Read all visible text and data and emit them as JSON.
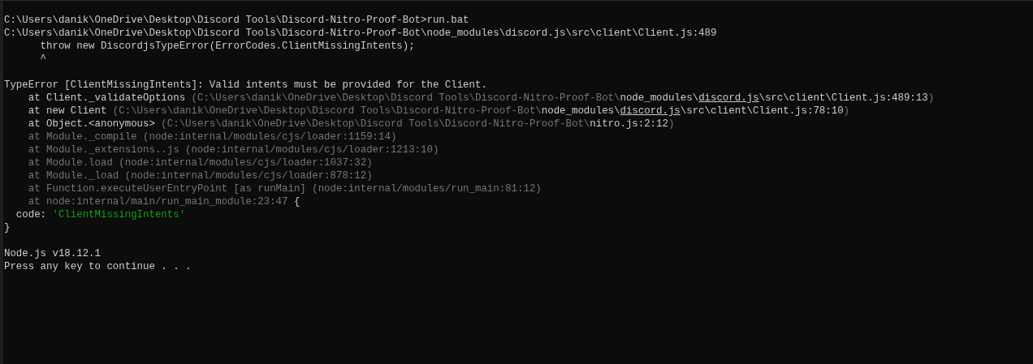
{
  "console": {
    "lines": [
      {
        "kind": "text",
        "segments": [
          {
            "kind": "plain",
            "text": "C:\\Users\\danik\\OneDrive\\Desktop\\Discord Tools\\Discord-Nitro-Proof-Bot>run.bat"
          }
        ]
      },
      {
        "kind": "text",
        "segments": [
          {
            "kind": "plain",
            "text": "C:\\Users\\danik\\OneDrive\\Desktop\\Discord Tools\\Discord-Nitro-Proof-Bot\\node_modules\\discord.js\\src\\client\\Client.js:489"
          }
        ]
      },
      {
        "kind": "text",
        "segments": [
          {
            "kind": "plain",
            "text": "      throw new DiscordjsTypeError(ErrorCodes.ClientMissingIntents);"
          }
        ]
      },
      {
        "kind": "text",
        "segments": [
          {
            "kind": "plain",
            "text": "      ^"
          }
        ]
      },
      {
        "kind": "blank"
      },
      {
        "kind": "text",
        "segments": [
          {
            "kind": "plain",
            "text": "TypeError [ClientMissingIntents]: Valid intents must be provided for the Client."
          }
        ]
      },
      {
        "kind": "text",
        "segments": [
          {
            "kind": "plain",
            "text": "    at Client._validateOptions "
          },
          {
            "kind": "dim",
            "text": "(C:\\Users\\danik\\OneDrive\\Desktop\\Discord Tools\\Discord-Nitro-Proof-Bot\\"
          },
          {
            "kind": "plain",
            "text": "node_modules\\"
          },
          {
            "kind": "link",
            "text": "discord.js"
          },
          {
            "kind": "plain",
            "text": "\\src\\client\\Client.js:489:13"
          },
          {
            "kind": "dim",
            "text": ")"
          }
        ]
      },
      {
        "kind": "text",
        "segments": [
          {
            "kind": "plain",
            "text": "    at new Client "
          },
          {
            "kind": "dim",
            "text": "(C:\\Users\\danik\\OneDrive\\Desktop\\Discord Tools\\Discord-Nitro-Proof-Bot\\"
          },
          {
            "kind": "plain",
            "text": "node_modules\\"
          },
          {
            "kind": "link",
            "text": "discord.js"
          },
          {
            "kind": "plain",
            "text": "\\src\\client\\Client.js:78:10"
          },
          {
            "kind": "dim",
            "text": ")"
          }
        ]
      },
      {
        "kind": "text",
        "segments": [
          {
            "kind": "plain",
            "text": "    at Object.<anonymous> "
          },
          {
            "kind": "dim",
            "text": "(C:\\Users\\danik\\OneDrive\\Desktop\\Discord Tools\\Discord-Nitro-Proof-Bot\\"
          },
          {
            "kind": "plain",
            "text": "nitro.js:2:12"
          },
          {
            "kind": "dim",
            "text": ")"
          }
        ]
      },
      {
        "kind": "text",
        "segments": [
          {
            "kind": "dim",
            "text": "    at Module._compile (node:internal/modules/cjs/loader:1159:14)"
          }
        ]
      },
      {
        "kind": "text",
        "segments": [
          {
            "kind": "dim",
            "text": "    at Module._extensions..js (node:internal/modules/cjs/loader:1213:10)"
          }
        ]
      },
      {
        "kind": "text",
        "segments": [
          {
            "kind": "dim",
            "text": "    at Module.load (node:internal/modules/cjs/loader:1037:32)"
          }
        ]
      },
      {
        "kind": "text",
        "segments": [
          {
            "kind": "dim",
            "text": "    at Module._load (node:internal/modules/cjs/loader:878:12)"
          }
        ]
      },
      {
        "kind": "text",
        "segments": [
          {
            "kind": "dim",
            "text": "    at Function.executeUserEntryPoint [as runMain] (node:internal/modules/run_main:81:12)"
          }
        ]
      },
      {
        "kind": "text",
        "segments": [
          {
            "kind": "dim",
            "text": "    at node:internal/main/run_main_module:23:47 "
          },
          {
            "kind": "plain",
            "text": "{"
          }
        ]
      },
      {
        "kind": "text",
        "segments": [
          {
            "kind": "plain",
            "text": "  code: "
          },
          {
            "kind": "string",
            "text": "'ClientMissingIntents'"
          }
        ]
      },
      {
        "kind": "text",
        "segments": [
          {
            "kind": "plain",
            "text": "}"
          }
        ]
      },
      {
        "kind": "blank"
      },
      {
        "kind": "text",
        "segments": [
          {
            "kind": "plain",
            "text": "Node.js v18.12.1"
          }
        ]
      },
      {
        "kind": "text",
        "segments": [
          {
            "kind": "plain",
            "text": "Press any key to continue . . ."
          }
        ]
      }
    ]
  }
}
